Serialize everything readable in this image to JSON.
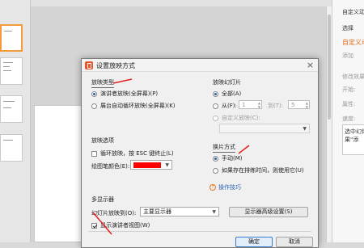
{
  "window": {
    "title": "设置放映方式",
    "close_glyph": "×"
  },
  "show_type": {
    "title": "放映类型",
    "options": [
      {
        "label": "演讲者放映(全屏幕)(P)",
        "checked": true
      },
      {
        "label": "展台自动循环放映(全屏幕)(K)",
        "checked": false
      }
    ]
  },
  "show_slides": {
    "title": "放映幻灯片",
    "all_label": "全部(A)",
    "from_label": "从(F):",
    "from_value": "1",
    "to_label": "到(T):",
    "to_value": "5",
    "custom_label": "自定义放映(C):"
  },
  "show_options": {
    "title": "放映选项",
    "loop_label": "循环放映，按 ESC 键终止(L)",
    "pen_color_label": "绘图笔颜色(E):",
    "pen_color": "#ff0000"
  },
  "advance": {
    "title": "换片方式",
    "manual_label": "手动(M)",
    "timings_label": "如果存在排练时间，则使用它(U)"
  },
  "tips_link": "操作技巧",
  "tips_glyph": "?",
  "multi_display": {
    "title": "多显示器",
    "show_on_label": "幻灯片放映到(O):",
    "show_on_value": "主要显示器",
    "advanced_button": "显示器高级设置(S)",
    "presenter_view_label": "显示演讲者视图(W)"
  },
  "buttons": {
    "ok": "确定",
    "cancel": "取消"
  },
  "right_panel": {
    "heading": "自定义动",
    "select_label": "选择",
    "section_title": "自定义动",
    "add_effect": "添加",
    "modify_label": "修改效果",
    "start_label": "开始:",
    "property_label": "属性:",
    "speed_label": "速度:",
    "hint_text_1": "选中幻灯",
    "hint_text_2": "果\"添"
  },
  "colors": {
    "accent": "#e06b1a",
    "annotation_red": "#e02020",
    "link_blue": "#2763b9"
  }
}
